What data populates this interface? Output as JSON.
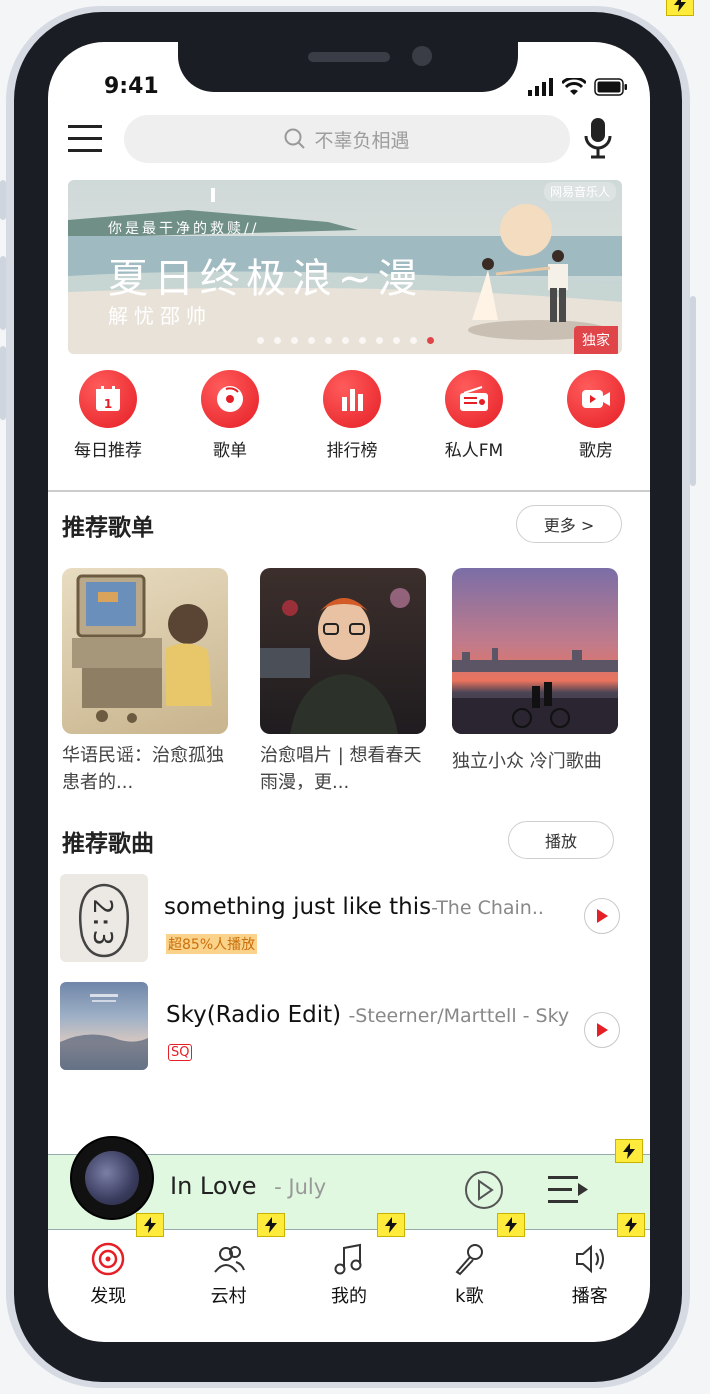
{
  "status_bar": {
    "time": "9:41"
  },
  "search": {
    "placeholder": "不辜负相遇"
  },
  "banner": {
    "small_text": "你是最干净的救赎//",
    "title": "夏日终极浪~漫",
    "subtitle": "解忧邵帅",
    "logo": "网易音乐人",
    "badge": "独家"
  },
  "quick_actions": [
    {
      "label": "每日推荐",
      "icon": "calendar-icon"
    },
    {
      "label": "歌单",
      "icon": "playlist-disc-icon"
    },
    {
      "label": "排行榜",
      "icon": "bar-chart-icon"
    },
    {
      "label": "私人FM",
      "icon": "radio-icon"
    },
    {
      "label": "歌房",
      "icon": "video-camera-icon"
    }
  ],
  "recommended_playlists": {
    "title": "推荐歌单",
    "more_label": "更多 >",
    "items": [
      {
        "title": "华语民谣：治愈孤独患者的..."
      },
      {
        "title": "治愈唱片 | 想看春天雨漫，更..."
      },
      {
        "title": "独立小众 冷门歌曲"
      }
    ]
  },
  "recommended_songs": {
    "title": "推荐歌曲",
    "play_label": "播放",
    "items": [
      {
        "title": "something just like this",
        "artist": "-The Chain..",
        "tag": "超85%人播放",
        "cover_text": "2:3"
      },
      {
        "title": "Sky(Radio Edit)",
        "artist": "-Steerner/Marttell - Sky",
        "tag": "SQ"
      }
    ]
  },
  "mini_player": {
    "title": "In Love",
    "artist": "- July"
  },
  "tabs": [
    {
      "label": "发现",
      "icon": "discover-disc-icon",
      "active": true
    },
    {
      "label": "云村",
      "icon": "community-users-icon"
    },
    {
      "label": "我的",
      "icon": "music-note-icon"
    },
    {
      "label": "k歌",
      "icon": "karaoke-mic-icon"
    },
    {
      "label": "播客",
      "icon": "speaker-icon"
    }
  ],
  "colors": {
    "accent": "#e51f26",
    "mini_player_bg": "#e0f7e0",
    "bolt": "#ffeb3b"
  }
}
